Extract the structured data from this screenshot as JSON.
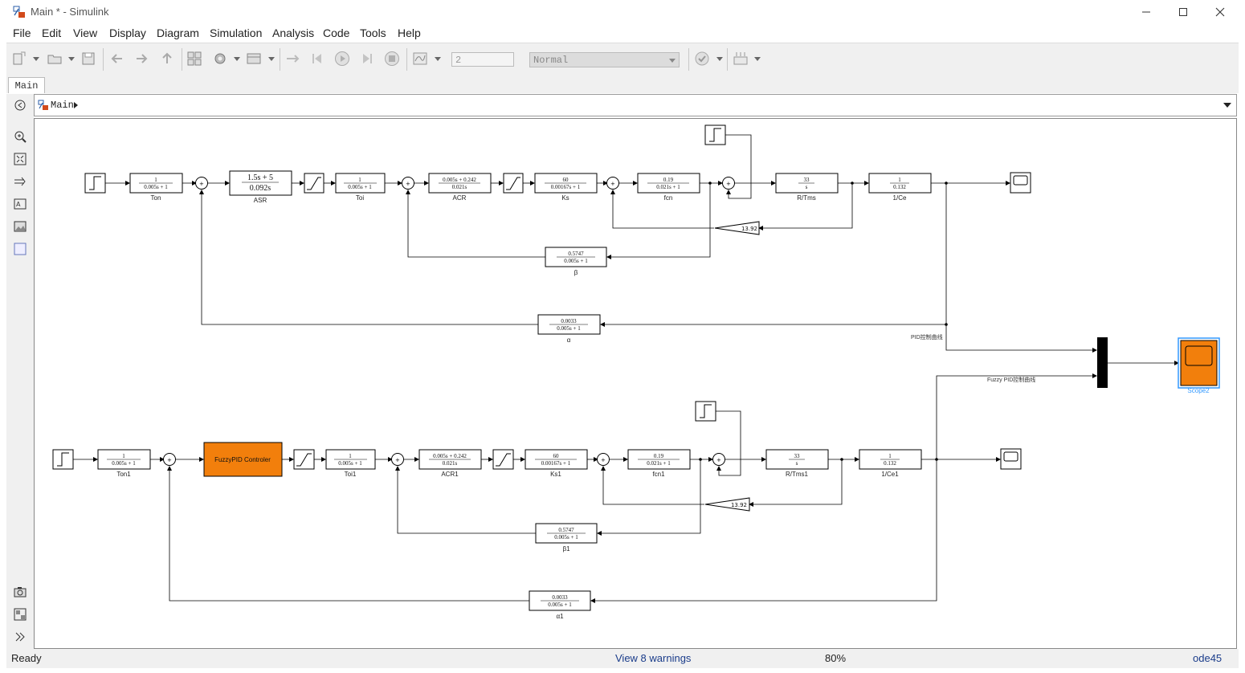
{
  "window": {
    "title": "Main * - Simulink"
  },
  "menu": [
    "File",
    "Edit",
    "View",
    "Display",
    "Diagram",
    "Simulation",
    "Analysis",
    "Code",
    "Tools",
    "Help"
  ],
  "toolbar": {
    "stop_time": "2",
    "sim_mode": "Normal"
  },
  "tab": {
    "label": "Main"
  },
  "breadcrumb": {
    "model": "Main"
  },
  "diagram": {
    "top": {
      "ton": {
        "num": "1",
        "den": "0.005s + 1",
        "name": "Ton"
      },
      "asr": {
        "num": "1.5s + 5",
        "den": "0.092s",
        "name": "ASR"
      },
      "toi": {
        "num": "1",
        "den": "0.005s + 1",
        "name": "Toi"
      },
      "acr": {
        "num": "0.005s + 0.242",
        "den": "0.021s",
        "name": "ACR"
      },
      "ks": {
        "num": "60",
        "den": "0.00167s + 1",
        "name": "Ks"
      },
      "fcn": {
        "num": "0.19",
        "den": "0.021s + 1",
        "name": "fcn"
      },
      "rtms": {
        "num": "33",
        "den": "s",
        "name": "R/Tms"
      },
      "ce": {
        "num": "1",
        "den": "0.132",
        "name": "1/Ce"
      },
      "gain": "13.92",
      "beta": {
        "num": "0.5747",
        "den": "0.005s + 1",
        "name": "β"
      },
      "alpha": {
        "num": "0.0033",
        "den": "0.005s + 1",
        "name": "α"
      }
    },
    "bottom": {
      "ton": {
        "num": "1",
        "den": "0.005s + 1",
        "name": "Ton1"
      },
      "fuzzy": "FuzzyPID Controler",
      "toi": {
        "num": "1",
        "den": "0.005s + 1",
        "name": "Toi1"
      },
      "acr": {
        "num": "0.005s + 0.242",
        "den": "0.021s",
        "name": "ACR1"
      },
      "ks": {
        "num": "60",
        "den": "0.00167s + 1",
        "name": "Ks1"
      },
      "fcn": {
        "num": "0.19",
        "den": "0.021s + 1",
        "name": "fcn1"
      },
      "rtms": {
        "num": "33",
        "den": "s",
        "name": "R/Tms1"
      },
      "ce": {
        "num": "1",
        "den": "0.132",
        "name": "1/Ce1"
      },
      "gain": "13.92",
      "beta": {
        "num": "0.5747",
        "den": "0.005s + 1",
        "name": "β1"
      },
      "alpha": {
        "num": "0.0033",
        "den": "0.005s + 1",
        "name": "α1"
      }
    },
    "signal_pid": "PID控制曲线",
    "signal_fuzzy": "Fuzzy PID控制曲线",
    "scope2": "Scope2"
  },
  "status": {
    "ready": "Ready",
    "warnings": "View 8 warnings",
    "zoom": "80%",
    "solver": "ode45"
  },
  "colors": {
    "fuzzy_block": "#f27f0c",
    "scope_highlight": "#3399ff"
  }
}
